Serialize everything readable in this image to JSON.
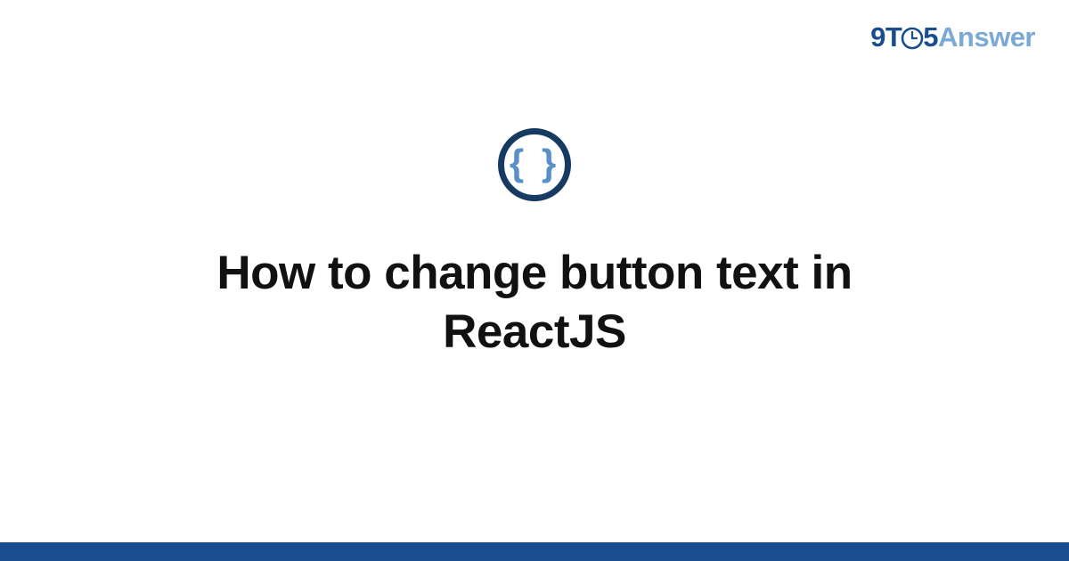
{
  "header": {
    "logo": {
      "part1": "9T",
      "part2": "5",
      "part3": "Answer"
    }
  },
  "main": {
    "category_icon": "code-braces-icon",
    "title": "How to change button text in ReactJS"
  },
  "colors": {
    "brand_dark": "#1a4d8f",
    "brand_light": "#7aa9d6",
    "icon_ring": "#173a63",
    "icon_braces": "#5a8fc9"
  }
}
